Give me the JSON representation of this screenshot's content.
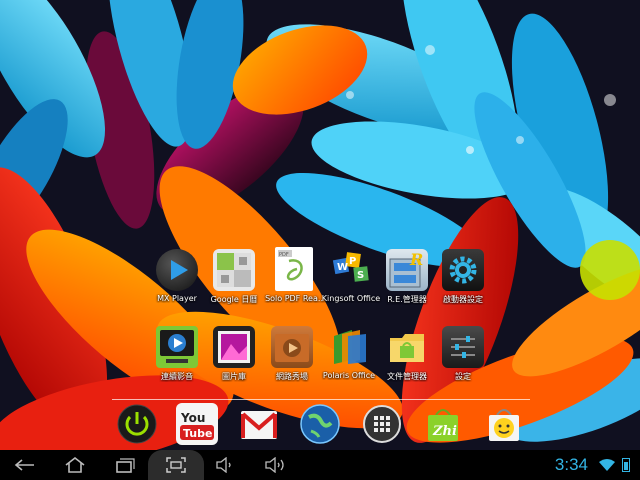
{
  "apps_row1": [
    {
      "label": "MX Player",
      "icon": "mx-player-icon"
    },
    {
      "label": "Google 日曆",
      "icon": "google-calendar-icon"
    },
    {
      "label": "Solo PDF Rea..",
      "icon": "solo-pdf-icon"
    },
    {
      "label": "Kingsoft Office",
      "icon": "kingsoft-office-icon"
    },
    {
      "label": "R.E.管理器",
      "icon": "re-manager-icon"
    },
    {
      "label": "啟動器設定",
      "icon": "launcher-settings-icon"
    }
  ],
  "apps_row2": [
    {
      "label": "連續影音",
      "icon": "video-player-icon"
    },
    {
      "label": "圖片庫",
      "icon": "gallery-icon"
    },
    {
      "label": "網路秀場",
      "icon": "web-video-icon"
    },
    {
      "label": "Polaris Office",
      "icon": "polaris-office-icon"
    },
    {
      "label": "文件管理器",
      "icon": "file-manager-icon"
    },
    {
      "label": "設定",
      "icon": "settings-icon"
    }
  ],
  "dock": [
    {
      "name": "power-icon"
    },
    {
      "name": "youtube-icon",
      "text": "You Tube"
    },
    {
      "name": "gmail-icon"
    },
    {
      "name": "browser-globe-icon"
    },
    {
      "name": "app-drawer-icon"
    },
    {
      "name": "zhi-store-icon",
      "text": "Zhi"
    },
    {
      "name": "smiley-shop-icon"
    }
  ],
  "status": {
    "time": "3:34",
    "wifi": "wifi-icon",
    "battery": "battery-icon"
  },
  "nav": [
    "back-icon",
    "home-icon",
    "recent-apps-icon",
    "screenshot-icon",
    "volume-down-icon",
    "volume-up-icon"
  ],
  "colors": {
    "accent": "#33b5e5",
    "petal_blue": "#1ec8f0",
    "petal_orange": "#ff6a00",
    "petal_red": "#e01818"
  }
}
